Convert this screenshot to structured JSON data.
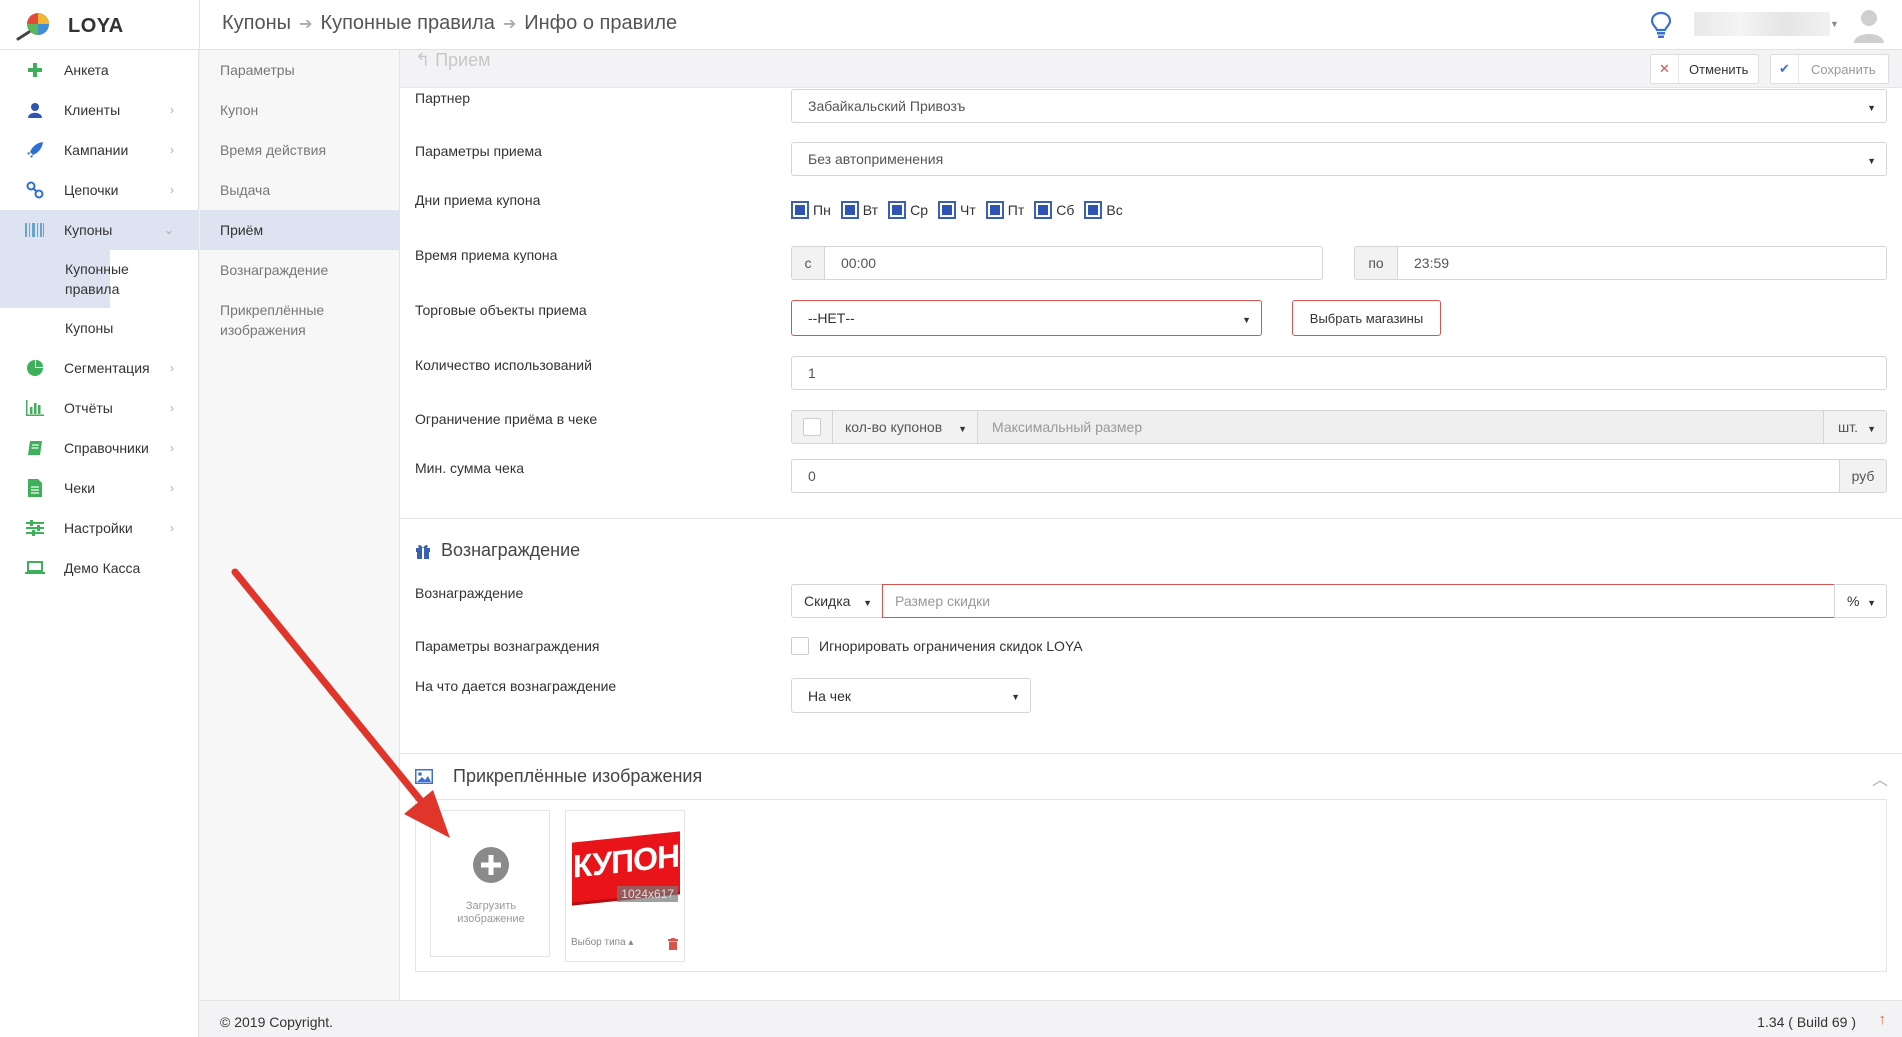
{
  "app": {
    "name": "LOYA"
  },
  "breadcrumb": [
    "Купоны",
    "Купонные правила",
    "Инфо о правиле"
  ],
  "sidebar": {
    "items": [
      {
        "label": "Анкета",
        "icon": "plus-icon"
      },
      {
        "label": "Клиенты",
        "icon": "user-icon"
      },
      {
        "label": "Кампании",
        "icon": "rocket-icon"
      },
      {
        "label": "Цепочки",
        "icon": "chain-icon"
      },
      {
        "label": "Купоны",
        "icon": "barcode-icon"
      },
      {
        "label": "Купонные правила"
      },
      {
        "label": "Купоны"
      },
      {
        "label": "Сегментация",
        "icon": "pie-chart-icon"
      },
      {
        "label": "Отчёты",
        "icon": "bar-chart-icon"
      },
      {
        "label": "Справочники",
        "icon": "book-icon"
      },
      {
        "label": "Чеки",
        "icon": "receipt-icon"
      },
      {
        "label": "Настройки",
        "icon": "sliders-icon"
      },
      {
        "label": "Демо Касса",
        "icon": "laptop-icon"
      }
    ]
  },
  "subnav": {
    "items": [
      "Параметры",
      "Купон",
      "Время действия",
      "Выдача",
      "Приём",
      "Вознаграждение",
      "Прикреплённые изображения"
    ]
  },
  "toolbar": {
    "section": "Прием",
    "cancel": "Отменить",
    "save": "Сохранить"
  },
  "form": {
    "partner": {
      "label": "Партнер",
      "value": "Забайкальский Привозъ"
    },
    "accept_params": {
      "label": "Параметры приема",
      "value": "Без автоприменения"
    },
    "days": {
      "label": "Дни приема купона",
      "items": [
        "Пн",
        "Вт",
        "Ср",
        "Чт",
        "Пт",
        "Сб",
        "Вс"
      ]
    },
    "time": {
      "label": "Время приема купона",
      "from_label": "с",
      "from": "00:00",
      "to_label": "по",
      "to": "23:59"
    },
    "stores": {
      "label": "Торговые объекты приема",
      "value": "--НЕТ--",
      "button": "Выбрать магазины"
    },
    "usage_count": {
      "label": "Количество использований",
      "value": "1"
    },
    "receipt_limit": {
      "label": "Ограничение приёма в чеке",
      "type": "кол-во купонов",
      "placeholder": "Максимальный размер",
      "unit": "шт."
    },
    "min_sum": {
      "label": "Мин. сумма чека",
      "value": "0",
      "unit": "руб"
    }
  },
  "reward": {
    "title": "Вознаграждение",
    "reward_label": "Вознаграждение",
    "reward_type": "Скидка",
    "reward_placeholder": "Размер скидки",
    "reward_unit": "%",
    "params_label": "Параметры вознаграждения",
    "ignore_limits": "Игнорировать ограничения скидок LOYA",
    "target_label": "На что дается вознаграждение",
    "target_value": "На чек"
  },
  "images": {
    "title": "Прикреплённые изображения",
    "upload": "Загрузить изображение",
    "image_text": "КУПОН",
    "image_size": "1024x617",
    "type_select": "Выбор типа"
  },
  "footer": {
    "copyright": "© 2019 Copyright.",
    "version": "1.34 ( Build 69 )"
  },
  "colors": {
    "accent": "#2f54b4",
    "error": "#d9534f",
    "active_bg": "#dde3f1",
    "arrow": "#e0352b"
  }
}
